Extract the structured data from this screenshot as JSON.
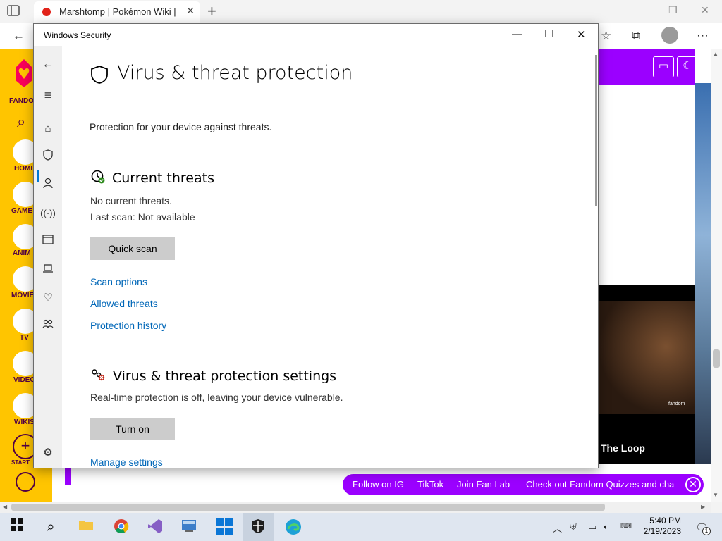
{
  "browser": {
    "tab_title": "Marshtomp | Pokémon Wiki | Far",
    "new_tab_glyph": "+",
    "tab_close_glyph": "✕"
  },
  "fandom": {
    "nav": [
      {
        "label": "FANDO"
      },
      {
        "label": "HOMI"
      },
      {
        "label": "GAME"
      },
      {
        "label": "ANIM"
      },
      {
        "label": "MOVIE"
      },
      {
        "label": "TV"
      },
      {
        "label": "VIDEO"
      },
      {
        "label": "WIKIS"
      },
      {
        "label": "START"
      }
    ],
    "video_title": "The Loop",
    "video_brand": "fandom",
    "fan_bar": {
      "links": [
        "Follow on IG",
        "TikTok",
        "Join Fan Lab",
        "Check out Fandom Quizzes and cha"
      ],
      "close_glyph": "✕"
    }
  },
  "ws": {
    "window_title": "Windows Security",
    "page_title": "Virus & threat protection",
    "page_subtitle": "Protection for your device against threats.",
    "current_threats": {
      "heading": "Current threats",
      "status": "No current threats.",
      "last_scan": "Last scan: Not available",
      "button": "Quick scan",
      "links": [
        "Scan options",
        "Allowed threats",
        "Protection history"
      ]
    },
    "settings": {
      "heading": "Virus & threat protection settings",
      "status": "Real-time protection is off, leaving your device vulnerable.",
      "button": "Turn on",
      "link": "Manage settings"
    }
  },
  "taskbar": {
    "time": "5:40 PM",
    "date": "2/19/2023",
    "notification_count": "1"
  },
  "colors": {
    "fandom_yellow": "#ffc500",
    "fandom_purple": "#9b00ff",
    "link_blue": "#0067b8",
    "accent_blue": "#0078d4"
  }
}
